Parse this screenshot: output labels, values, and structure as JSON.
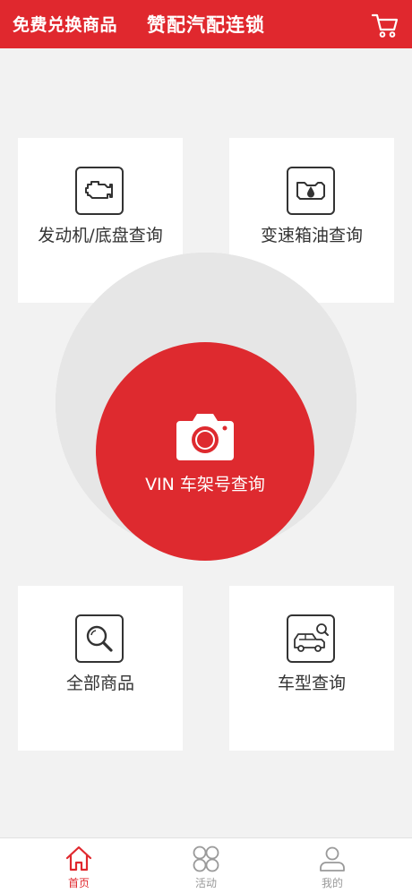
{
  "header": {
    "promo_label": "免费兑换商品",
    "title": "赞配汽配连锁",
    "cart_icon": "cart-icon"
  },
  "cards": {
    "engine": {
      "label": "发动机/底盘查询",
      "icon": "engine-icon"
    },
    "transmission": {
      "label": "变速箱油查询",
      "icon": "transmission-oil-icon"
    },
    "all_products": {
      "label": "全部商品",
      "icon": "magnifier-icon"
    },
    "car_model": {
      "label": "车型查询",
      "icon": "car-search-icon"
    }
  },
  "vin": {
    "label": "VIN 车架号查询",
    "icon": "camera-icon"
  },
  "tabs": [
    {
      "label": "首页",
      "icon": "home-icon",
      "active": true
    },
    {
      "label": "活动",
      "icon": "activity-grid-icon",
      "active": false
    },
    {
      "label": "我的",
      "icon": "user-icon",
      "active": false
    }
  ],
  "colors": {
    "brand_red": "#e0282e",
    "background": "#f2f2f2",
    "ring": "#e6e6e6",
    "text": "#333333",
    "tab_inactive": "#999999"
  }
}
